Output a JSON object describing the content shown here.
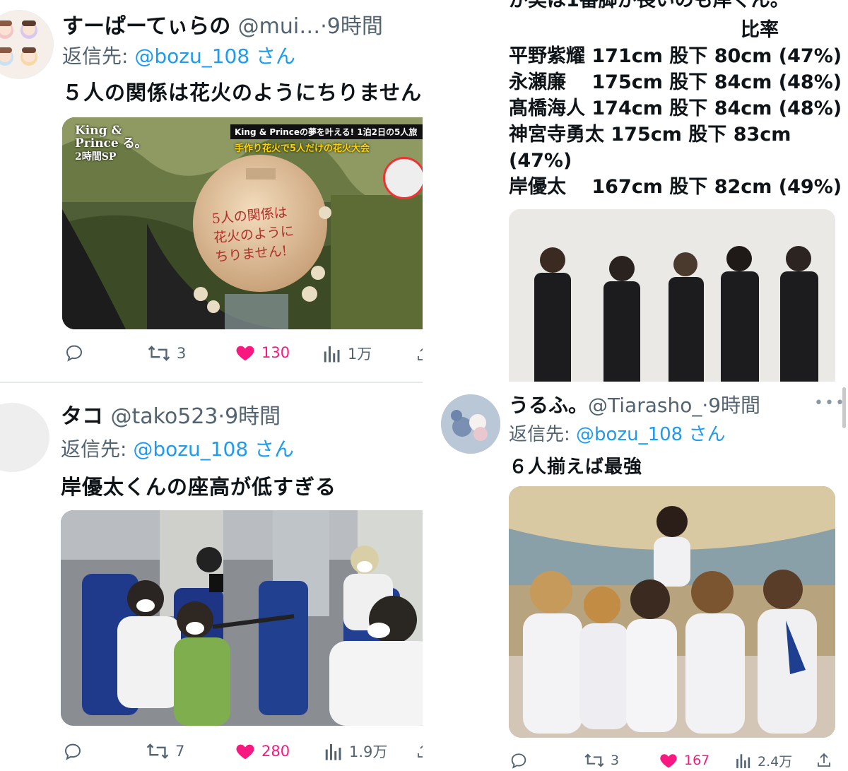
{
  "tweets": [
    {
      "display_name": "すーぱーてぃらの",
      "handle": "@mui…",
      "time": "·9時間",
      "reply_prefix": "返信先: ",
      "reply_to": "@bozu_108 さん",
      "text": "５人の関係は花火のようにちりません",
      "media": {
        "badge_brand": "King & Prince る。",
        "badge_sub": "2時間SP",
        "headline_1": "King & Princeの夢を叶える! 1泊2日の5人旅",
        "headline_2": "手作り花火で5人だけの花火大会",
        "handwriting": [
          "5人の関係は",
          "花火のように",
          "ちりません!"
        ]
      },
      "stats": {
        "replies": "",
        "retweets": "3",
        "likes": "130",
        "views": "1万"
      }
    },
    {
      "display_name": "タコ",
      "handle": "@tako523",
      "time": "·9時間",
      "reply_prefix": "返信先: ",
      "reply_to": "@bozu_108 さん",
      "text": "岸優太くんの座高が低すぎる",
      "stats": {
        "replies": "",
        "retweets": "7",
        "likes": "280",
        "views": "1.9万"
      }
    },
    {
      "display_name": "うるふ。",
      "handle": "@Tiarasho_",
      "time": "·9時間",
      "reply_prefix": "返信先: ",
      "reply_to": "@bozu_108 さん",
      "text": "６人揃えば最強",
      "stats": {
        "replies": "",
        "retweets": "3",
        "likes": "167",
        "views": "2.4万"
      }
    }
  ],
  "height_post": {
    "cut_line": "が実は1番脚が長いのも岸くん。",
    "ratio_header": "比率",
    "rows": [
      "平野紫耀 171cm 股下 80cm (47%)",
      "永瀬廉　 175cm 股下 84cm (48%)",
      "髙橋海人 174cm 股下 84cm (48%)",
      "神宮寺勇太 175cm 股下 83cm",
      "(47%)",
      "岸優太　 167cm 股下 82cm (49%)"
    ]
  },
  "colors": {
    "text": "#0f1419",
    "secondary": "#536471",
    "link": "#1d9bf0",
    "like": "#f91880",
    "divider": "#e6e9ec"
  },
  "icons": [
    "reply-icon",
    "retweet-icon",
    "heart-icon",
    "views-icon",
    "share-icon",
    "more-icon"
  ]
}
